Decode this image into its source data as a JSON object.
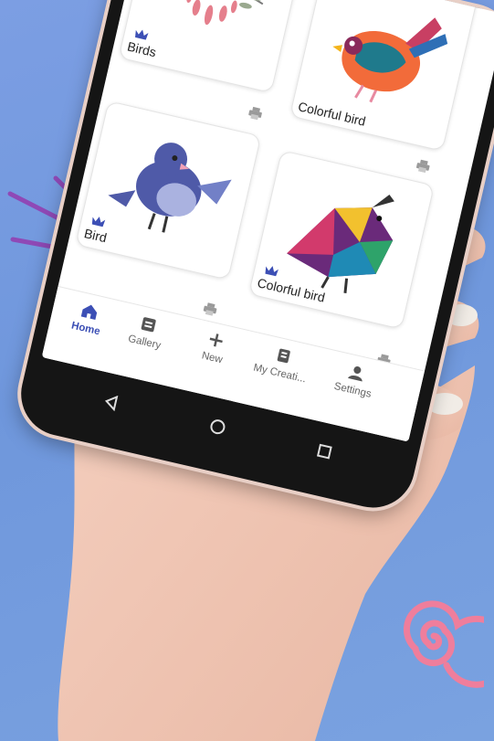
{
  "background_color": "#7a9de2",
  "accent_color": "#3c4fb5",
  "decorations": {
    "heart_icon": "heart-outline-icon",
    "lines_icon": "accent-lines-icon",
    "spiral_icon": "spiral-icon"
  },
  "cards": [
    {
      "label": "Birds",
      "premium": true,
      "art": "birds-couple-illustration"
    },
    {
      "label": "Colorful bird",
      "premium": false,
      "art": "colorful-bird-illustration"
    },
    {
      "label": "Bird",
      "premium": true,
      "art": "blue-bird-illustration"
    },
    {
      "label": "Colorful bird",
      "premium": true,
      "art": "geometric-quail-illustration"
    }
  ],
  "tabs": [
    {
      "label": "Home",
      "icon": "home-icon",
      "active": true
    },
    {
      "label": "Gallery",
      "icon": "gallery-icon",
      "active": false
    },
    {
      "label": "New",
      "icon": "plus-icon",
      "active": false
    },
    {
      "label": "My Creati...",
      "icon": "creations-icon",
      "active": false
    },
    {
      "label": "Settings",
      "icon": "person-icon",
      "active": false
    }
  ],
  "system_nav": [
    "back-icon",
    "home-circle-icon",
    "recents-icon"
  ]
}
